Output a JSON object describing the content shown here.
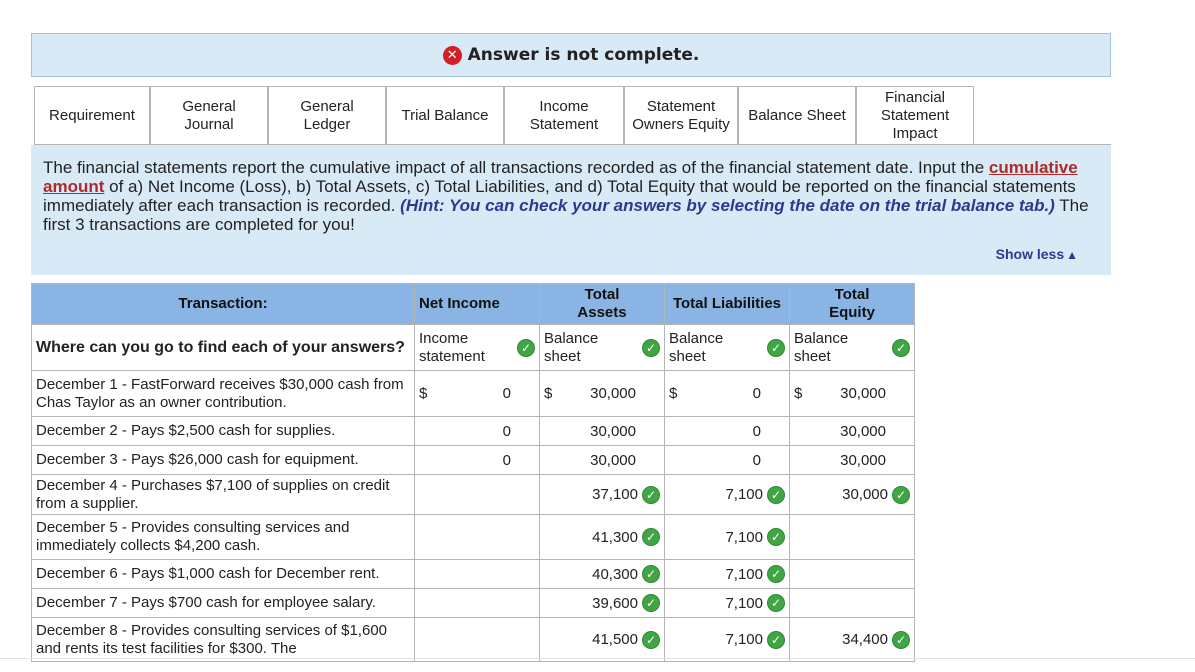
{
  "banner": {
    "text": "Answer is not complete.",
    "icon": "x-circle-icon",
    "icon_color": "#d32027"
  },
  "tabs": [
    {
      "label": "Requirement"
    },
    {
      "label": "General Journal"
    },
    {
      "label": "General Ledger"
    },
    {
      "label": "Trial Balance"
    },
    {
      "label": "Income Statement"
    },
    {
      "label": "Statement Owners Equity"
    },
    {
      "label": "Balance Sheet"
    },
    {
      "label": "Financial Statement Impact"
    }
  ],
  "instructions": {
    "part1": "The financial statements report the cumulative impact of all transactions recorded as of the financial statement date. Input the ",
    "emphasis": "cumulative amount",
    "part2": " of a) Net Income (Loss), b) Total Assets, c) Total Liabilities, and d) Total Equity that would be reported on the financial statements immediately after each transaction is recorded. ",
    "hint": "(Hint: You can check your answers by selecting the date on the trial balance tab.)",
    "part3": " The first 3 transactions are completed for you!",
    "show_less": "Show less"
  },
  "table": {
    "headers": {
      "transaction": "Transaction:",
      "net_income": "Net Income",
      "total_assets": "Total Assets",
      "total_liabilities": "Total Liabilities",
      "total_equity": "Total Equity"
    },
    "question": "Where can you go to find each of your answers?",
    "locations": {
      "net_income": "Income statement",
      "total_assets": "Balance sheet",
      "total_liabilities": "Balance sheet",
      "total_equity": "Balance sheet"
    },
    "currency": "$",
    "rows": [
      {
        "desc": "December 1 - FastForward receives $30,000 cash from Chas Taylor as an owner contribution.",
        "ni": "0",
        "ta": "30,000",
        "tl": "0",
        "te": "30,000"
      },
      {
        "desc": "December 2 - Pays $2,500 cash for supplies.",
        "ni": "0",
        "ta": "30,000",
        "tl": "0",
        "te": "30,000"
      },
      {
        "desc": "December 3 - Pays $26,000 cash for equipment.",
        "ni": "0",
        "ta": "30,000",
        "tl": "0",
        "te": "30,000"
      },
      {
        "desc": "December 4 - Purchases $7,100 of supplies on credit from a supplier.",
        "ni": "",
        "ta": "37,100",
        "tl": "7,100",
        "te": "30,000"
      },
      {
        "desc": "December 5 - Provides consulting services and immediately collects $4,200 cash.",
        "ni": "",
        "ta": "41,300",
        "tl": "7,100",
        "te": ""
      },
      {
        "desc": "December 6 - Pays $1,000 cash for December rent.",
        "ni": "",
        "ta": "40,300",
        "tl": "7,100",
        "te": ""
      },
      {
        "desc": "December 7 - Pays $700 cash for employee salary.",
        "ni": "",
        "ta": "39,600",
        "tl": "7,100",
        "te": ""
      },
      {
        "desc": "December 8 - Provides consulting services of $1,600 and rents its test facilities for $300. The",
        "ni": "",
        "ta": "41,500",
        "tl": "7,100",
        "te": "34,400"
      }
    ]
  },
  "check_icon": "check-circle-icon",
  "check_color": "#41a545"
}
